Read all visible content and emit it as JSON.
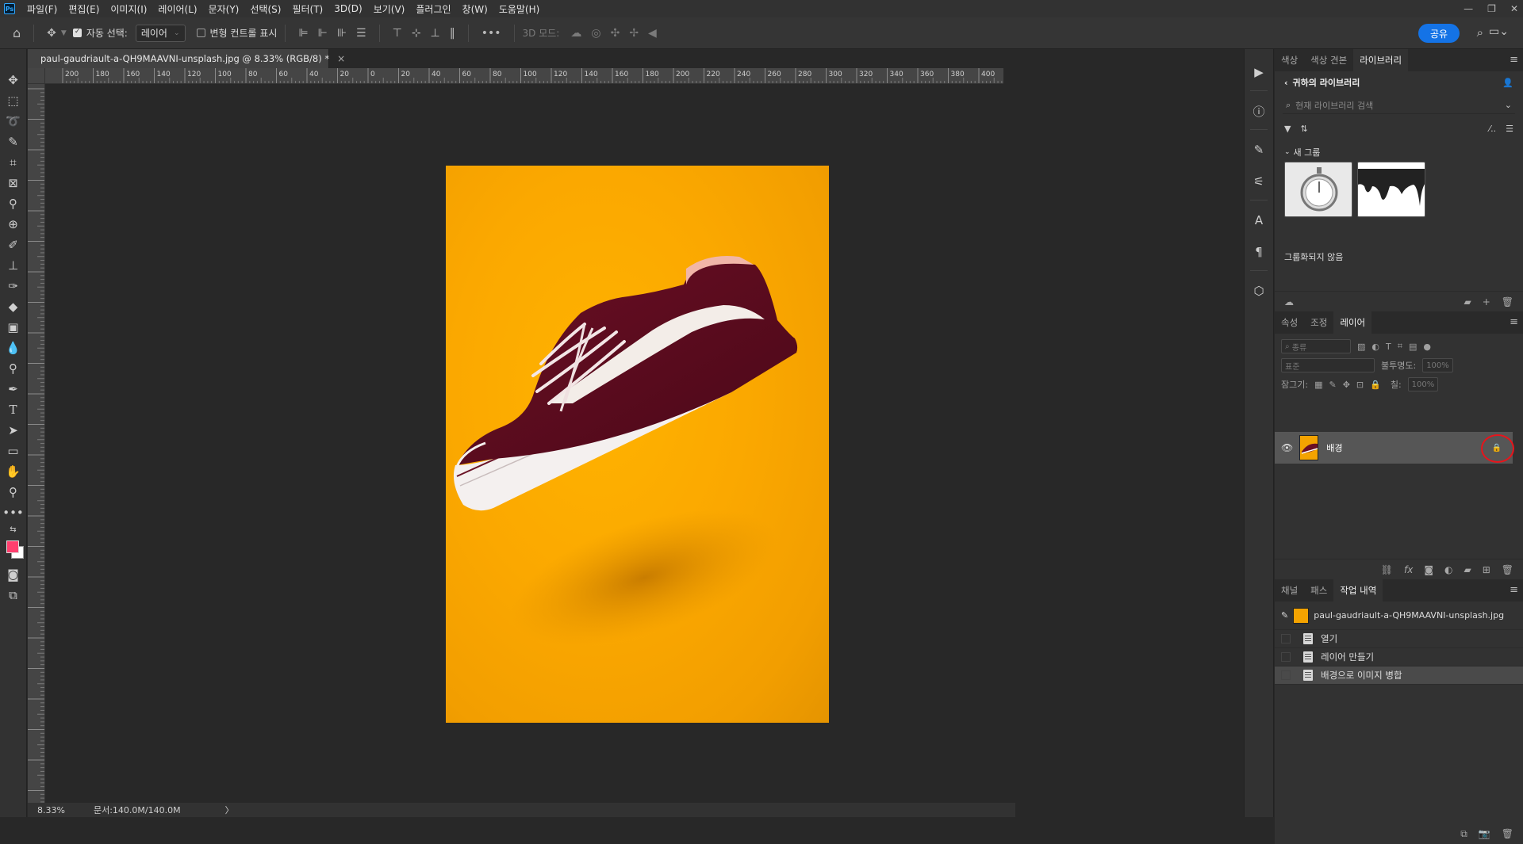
{
  "app": {
    "logo": "Ps",
    "menu": [
      "파일(F)",
      "편집(E)",
      "이미지(I)",
      "레이어(L)",
      "문자(Y)",
      "선택(S)",
      "필터(T)",
      "3D(D)",
      "보기(V)",
      "플러그인",
      "창(W)",
      "도움말(H)"
    ]
  },
  "options": {
    "auto_select_label": "자동 선택:",
    "auto_select_value": "레이어",
    "transform_controls_label": "변형 컨트롤 표시",
    "mode_3d_label": "3D 모드:",
    "share_label": "공유"
  },
  "document": {
    "tab_title": "paul-gaudriault-a-QH9MAAVNI-unsplash.jpg @ 8.33% (RGB/8) *",
    "close": "×",
    "ruler_top_ticks": [
      "200",
      "180",
      "160",
      "140",
      "120",
      "100",
      "80",
      "60",
      "40",
      "20",
      "0",
      "20",
      "40",
      "60",
      "80",
      "100",
      "120",
      "140",
      "160",
      "180",
      "200",
      "220",
      "240",
      "260",
      "280",
      "300",
      "320",
      "340",
      "360",
      "380",
      "400"
    ],
    "zoom": "8.33%",
    "doc_size": "문서:140.0M/140.0M",
    "status_arrow": "〉"
  },
  "libraries_panel": {
    "tabs": [
      "색상",
      "색상 견본",
      "라이브러리"
    ],
    "active_tab": 2,
    "library_name": "귀하의 라이브러리",
    "search_placeholder": "현재 라이브러리 검색",
    "group_name": "새 그룹",
    "ungrouped_label": "그룹화되지 않음"
  },
  "layers_panel": {
    "tabs": [
      "속성",
      "조정",
      "레이어"
    ],
    "active_tab": 2,
    "filter_kind": "종류",
    "blend_mode": "표준",
    "opacity_label": "불투명도:",
    "opacity_value": "100%",
    "lock_label": "잠그기:",
    "fill_label": "칠:",
    "fill_value": "100%",
    "layers": [
      {
        "name": "배경",
        "visible": true,
        "locked": true
      }
    ]
  },
  "history_panel": {
    "tabs": [
      "채널",
      "패스",
      "작업 내역"
    ],
    "active_tab": 2,
    "snapshot_name": "paul-gaudriault-a-QH9MAAVNI-unsplash.jpg",
    "steps": [
      "열기",
      "레이어 만들기",
      "배경으로 이미지 병합"
    ],
    "selected_step": 2
  },
  "colors": {
    "foreground": "#ff3f6e",
    "background": "#ffffff",
    "accent": "#1473e6",
    "highlight_circle": "#e8141b",
    "photo_bg": "#fba800"
  }
}
